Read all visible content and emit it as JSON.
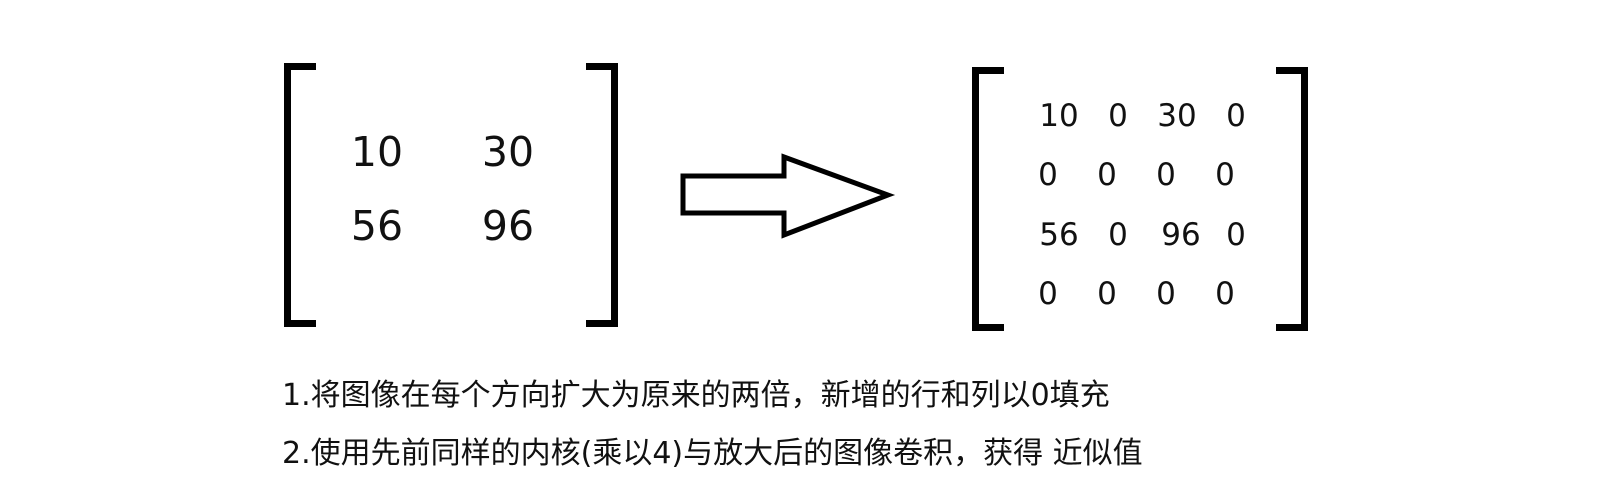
{
  "left_matrix": {
    "rows": [
      [
        "10",
        "30"
      ],
      [
        "56",
        "96"
      ]
    ]
  },
  "right_matrix": {
    "rows": [
      [
        "10",
        "0",
        "30",
        "0"
      ],
      [
        "0",
        "0",
        "0",
        "0"
      ],
      [
        "56",
        "0",
        "96",
        "0"
      ],
      [
        "0",
        "0",
        "0",
        "0"
      ]
    ]
  },
  "captions": [
    "1.将图像在每个方向扩大为原来的两倍，新增的行和列以0填充",
    "2.使用先前同样的内核(乘以4)与放大后的图像卷积，获得 近似值"
  ]
}
